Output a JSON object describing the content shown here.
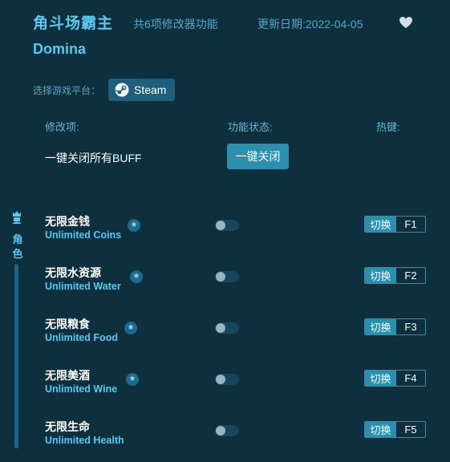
{
  "header": {
    "title_cn": "角斗场霸主",
    "feature_count": "共6项修改器功能",
    "update_date": "更新日期:2022-04-05",
    "title_en": "Domina",
    "favorite_icon": "heart-icon"
  },
  "platform": {
    "label": "选择游戏平台：",
    "steam_label": "Steam",
    "steam_icon": "steam-icon"
  },
  "columns": {
    "mod": "修改项:",
    "state": "功能状态:",
    "hotkey": "热键:"
  },
  "buff": {
    "label": "一键关闭所有BUFF",
    "button": "一键关闭"
  },
  "sidebar": {
    "label": "角色",
    "icon": "character-icon"
  },
  "cheats": [
    {
      "cn": "无限金钱",
      "en": "Unlimited Coins",
      "switch": "切换",
      "key": "F1",
      "starred": true,
      "enabled": false
    },
    {
      "cn": "无限水资源",
      "en": "Unlimited Water",
      "switch": "切换",
      "key": "F2",
      "starred": true,
      "enabled": false
    },
    {
      "cn": "无限粮食",
      "en": "Unlimited Food",
      "switch": "切换",
      "key": "F3",
      "starred": true,
      "enabled": false
    },
    {
      "cn": "无限美酒",
      "en": "Unlimited Wine",
      "switch": "切换",
      "key": "F4",
      "starred": true,
      "enabled": false
    },
    {
      "cn": "无限生命",
      "en": "Unlimited Health",
      "switch": "切换",
      "key": "F5",
      "starred": false,
      "enabled": false
    }
  ],
  "colors": {
    "background": "#0d2f3e",
    "accent": "#5cc8ee",
    "button": "#2d8fae"
  }
}
